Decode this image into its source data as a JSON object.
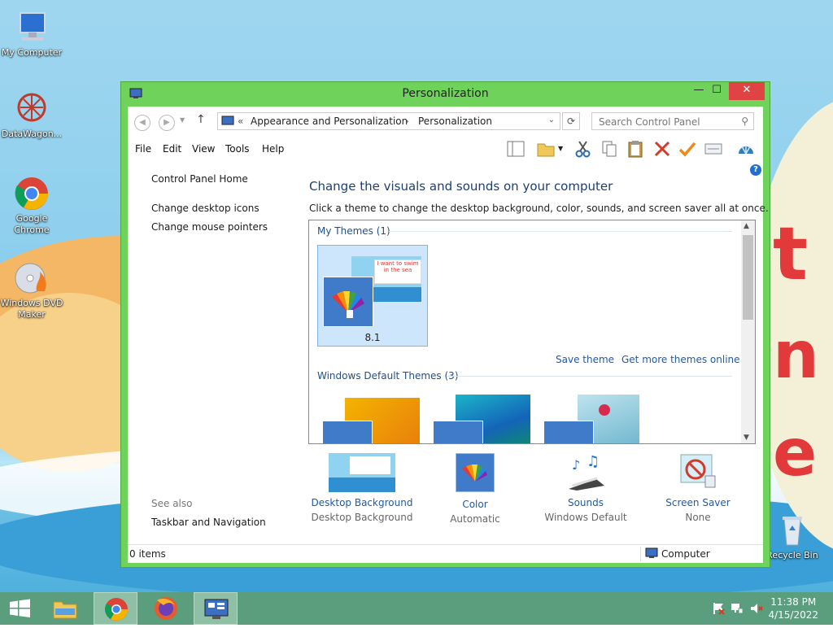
{
  "desktop": {
    "icons": [
      {
        "label": "My Computer",
        "icon": "computer-icon"
      },
      {
        "label": "DataWagon...",
        "icon": "datawagon-icon"
      },
      {
        "label": "Google Chrome",
        "icon": "chrome-icon"
      },
      {
        "label": "Windows DVD Maker",
        "icon": "dvd-maker-icon"
      },
      {
        "label": "Recycle Bin",
        "icon": "recycle-bin-icon"
      }
    ]
  },
  "window": {
    "title": "Personalization",
    "buttons": {
      "minimize": "—",
      "maximize": "☐",
      "close": "✕"
    },
    "address": {
      "prefix": "«",
      "crumb1": "Appearance and Personalization",
      "sep": "›",
      "crumb2": "Personalization"
    },
    "search_placeholder": "Search Control Panel",
    "menu": [
      "File",
      "Edit",
      "View",
      "Tools",
      "Help"
    ],
    "left_pane": {
      "home": "Control Panel Home",
      "links": [
        "Change desktop icons",
        "Change mouse pointers"
      ],
      "see_also": "See also",
      "see_also_links": [
        "Taskbar and Navigation"
      ]
    },
    "main": {
      "heading": "Change the visuals and sounds on your computer",
      "subheading": "Click a theme to change the desktop background, color, sounds, and screen saver all at once.",
      "my_themes_label": "My Themes (1)",
      "my_theme_name": "8.1",
      "save_theme": "Save theme",
      "get_more": "Get more themes online",
      "default_themes_label": "Windows Default Themes (3)",
      "theme_image_text": "I want to swim in the sea"
    },
    "bottom": [
      {
        "label": "Desktop Background",
        "sub": "Desktop Background"
      },
      {
        "label": "Color",
        "sub": "Automatic"
      },
      {
        "label": "Sounds",
        "sub": "Windows Default"
      },
      {
        "label": "Screen Saver",
        "sub": "None"
      }
    ],
    "status": {
      "items": "0 items",
      "location": "Computer"
    }
  },
  "taskbar": {
    "time": "11:38 PM",
    "date": "4/15/2022"
  },
  "colors": {
    "window_frame": "#6fd25a",
    "close_button": "#e04343",
    "link_blue": "#1e5aa8",
    "taskbar": "#5a9e7d"
  }
}
